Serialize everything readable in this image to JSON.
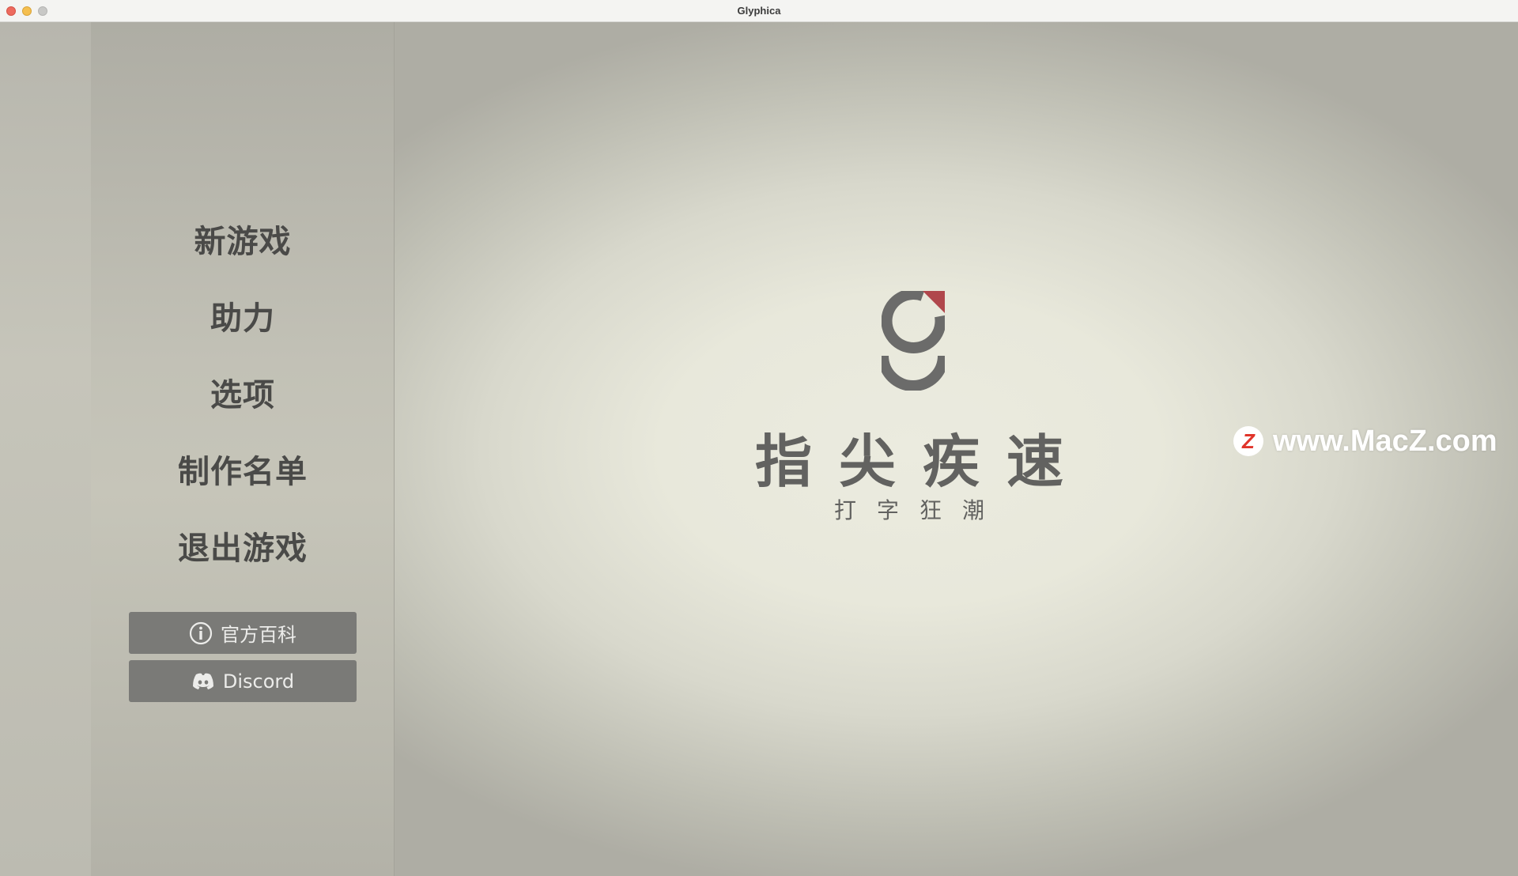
{
  "window": {
    "title": "Glyphica"
  },
  "menu": {
    "items": [
      {
        "id": "new-game",
        "label": "新游戏"
      },
      {
        "id": "assist",
        "label": "助力"
      },
      {
        "id": "options",
        "label": "选项"
      },
      {
        "id": "credits",
        "label": "制作名单"
      },
      {
        "id": "quit",
        "label": "退出游戏"
      }
    ],
    "wiki_label": "官方百科",
    "discord_label": "Discord"
  },
  "branding": {
    "title": "指尖疾速",
    "subtitle": "打字狂潮",
    "logo_icon": "glyphica-g-logo",
    "logo_color": "#6b6b6a",
    "accent_color": "#b0474c"
  },
  "watermark": {
    "badge": "Z",
    "text": "www.MacZ.com"
  },
  "colors": {
    "background": "#e8e8db",
    "menu_panel": "#c2c1b6",
    "button": "#7a7a77",
    "text": "#4a4a48"
  }
}
